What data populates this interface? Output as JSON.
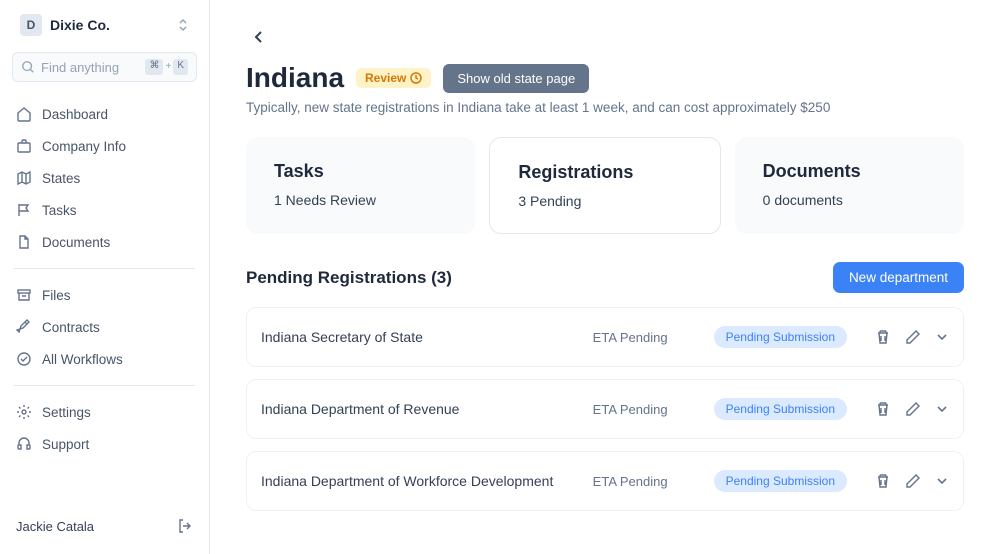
{
  "org": {
    "initial": "D",
    "name": "Dixie Co."
  },
  "search": {
    "placeholder": "Find anything",
    "kbd1": "⌘",
    "kbd2": "K"
  },
  "nav": {
    "primary": [
      {
        "label": "Dashboard"
      },
      {
        "label": "Company Info"
      },
      {
        "label": "States"
      },
      {
        "label": "Tasks"
      },
      {
        "label": "Documents"
      }
    ],
    "secondary": [
      {
        "label": "Files"
      },
      {
        "label": "Contracts"
      },
      {
        "label": "All Workflows"
      }
    ],
    "tertiary": [
      {
        "label": "Settings"
      },
      {
        "label": "Support"
      }
    ]
  },
  "user": {
    "name": "Jackie Catala"
  },
  "page": {
    "title": "Indiana",
    "review_badge": "Review",
    "old_page_btn": "Show old state page",
    "subtitle": "Typically, new state registrations in Indiana take at least 1 week, and can cost approximately $250"
  },
  "cards": {
    "tasks": {
      "title": "Tasks",
      "stat": "1 Needs Review"
    },
    "registrations": {
      "title": "Registrations",
      "stat": "3 Pending"
    },
    "documents": {
      "title": "Documents",
      "stat": "0 documents"
    }
  },
  "registrations": {
    "section_title": "Pending Registrations (3)",
    "new_btn": "New department",
    "rows": [
      {
        "name": "Indiana Secretary of State",
        "eta": "ETA Pending",
        "status": "Pending Submission"
      },
      {
        "name": "Indiana Department of Revenue",
        "eta": "ETA Pending",
        "status": "Pending Submission"
      },
      {
        "name": "Indiana Department of Workforce Development",
        "eta": "ETA Pending",
        "status": "Pending Submission"
      }
    ]
  }
}
